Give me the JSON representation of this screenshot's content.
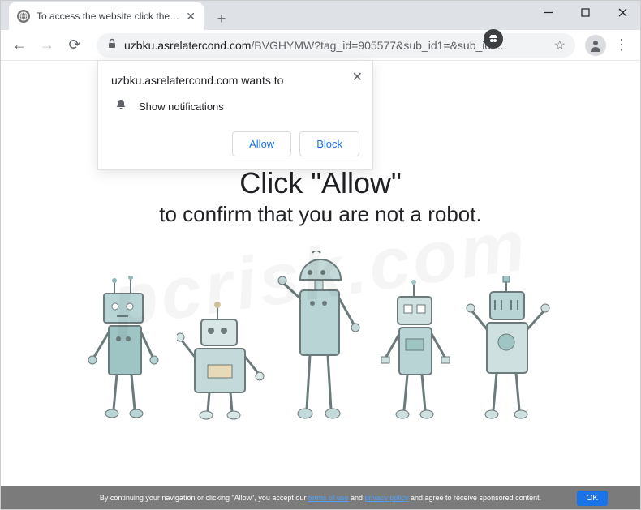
{
  "window": {
    "tab_title": "To access the website click the \"A",
    "url_domain": "uzbku.asrelatercond.com",
    "url_path": "/BVGHYMW?tag_id=905577&sub_id1=&sub_id2..."
  },
  "permission": {
    "origin_wants": "uzbku.asrelatercond.com wants to",
    "line": "Show notifications",
    "allow": "Allow",
    "block": "Block"
  },
  "page": {
    "headline": "Click \"Allow\"",
    "subline": "to confirm that you are not a robot."
  },
  "footer": {
    "pre": "By continuing your navigation or clicking \"Allow\", you accept our ",
    "terms": "terms of use",
    "mid": " and ",
    "privacy": "privacy policy",
    "post": " and agree to receive sponsored content.",
    "ok": "OK"
  },
  "watermark": "pcrisk.com"
}
